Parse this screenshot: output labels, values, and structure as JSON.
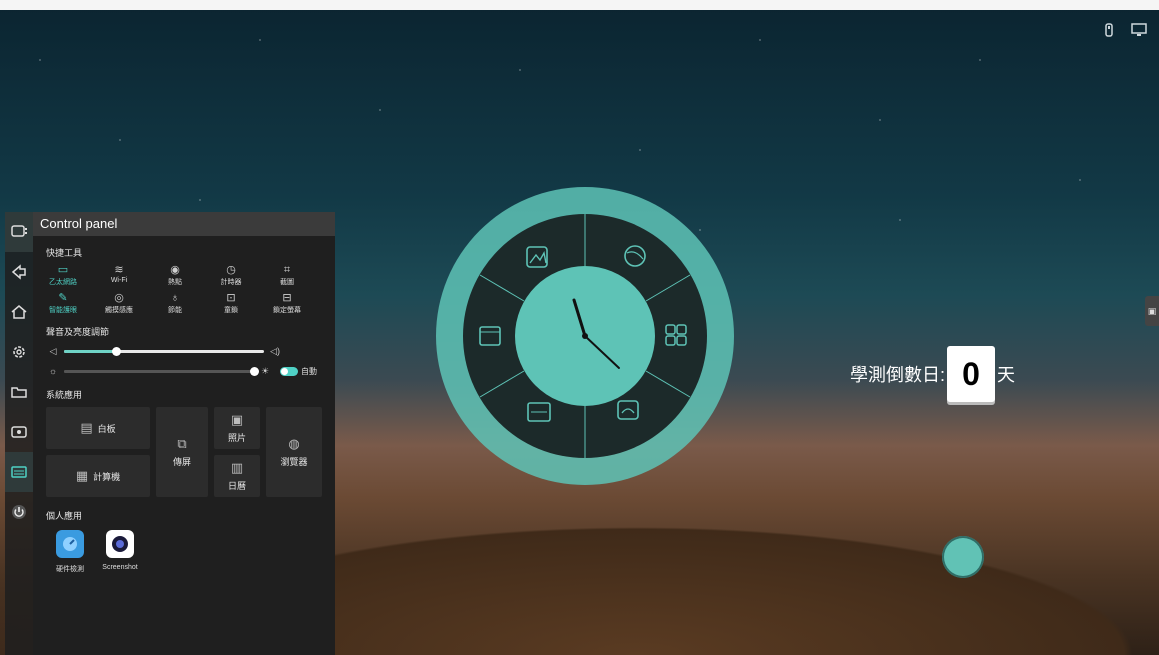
{
  "panel": {
    "title": "Control panel",
    "quick_tools_label": "快捷工具",
    "quick_tools": [
      {
        "label": "乙太網路",
        "icon": "ethernet-icon",
        "active": true
      },
      {
        "label": "Wi-Fi",
        "icon": "wifi-icon",
        "active": false
      },
      {
        "label": "熱點",
        "icon": "hotspot-icon",
        "active": false
      },
      {
        "label": "計時器",
        "icon": "timer-icon",
        "active": false
      },
      {
        "label": "截圖",
        "icon": "crop-icon",
        "active": false
      },
      {
        "label": "智能護眼",
        "icon": "eye-care-icon",
        "active": true
      },
      {
        "label": "觸摸感應",
        "icon": "touch-icon",
        "active": false
      },
      {
        "label": "節能",
        "icon": "energy-saving-icon",
        "active": false
      },
      {
        "label": "童鎖",
        "icon": "child-lock-icon",
        "active": false
      },
      {
        "label": "鎖定螢幕",
        "icon": "screen-lock-icon",
        "active": false
      }
    ],
    "sound_brightness_label": "聲音及亮度調節",
    "volume_level": 0.26,
    "brightness_level": 1.0,
    "auto_label": "自動",
    "system_apps_label": "系統應用",
    "system_apps": {
      "whiteboard": "白板",
      "screen_share": "傳屏",
      "photos": "照片",
      "browser": "瀏覽器",
      "calculator": "計算機",
      "calendar": "日曆"
    },
    "personal_apps_label": "個人應用",
    "personal_apps": [
      {
        "label": "硬件檢測",
        "icon": "hardware-check-icon",
        "color": "#3a9be0"
      },
      {
        "label": "Screenshot",
        "icon": "screenshot-icon",
        "color": "#ffffff"
      }
    ]
  },
  "dock": {
    "items": [
      "panel-icon",
      "back-icon",
      "home-icon",
      "settings-icon",
      "folder-icon",
      "source-icon",
      "keyboard-icon",
      "power-icon"
    ]
  },
  "countdown": {
    "label": "學測倒數日:",
    "days": "0",
    "unit": "天"
  },
  "colors": {
    "accent": "#4fd1c5",
    "dial": "#5ec3b6",
    "panel_bg": "#1f1f1f"
  }
}
